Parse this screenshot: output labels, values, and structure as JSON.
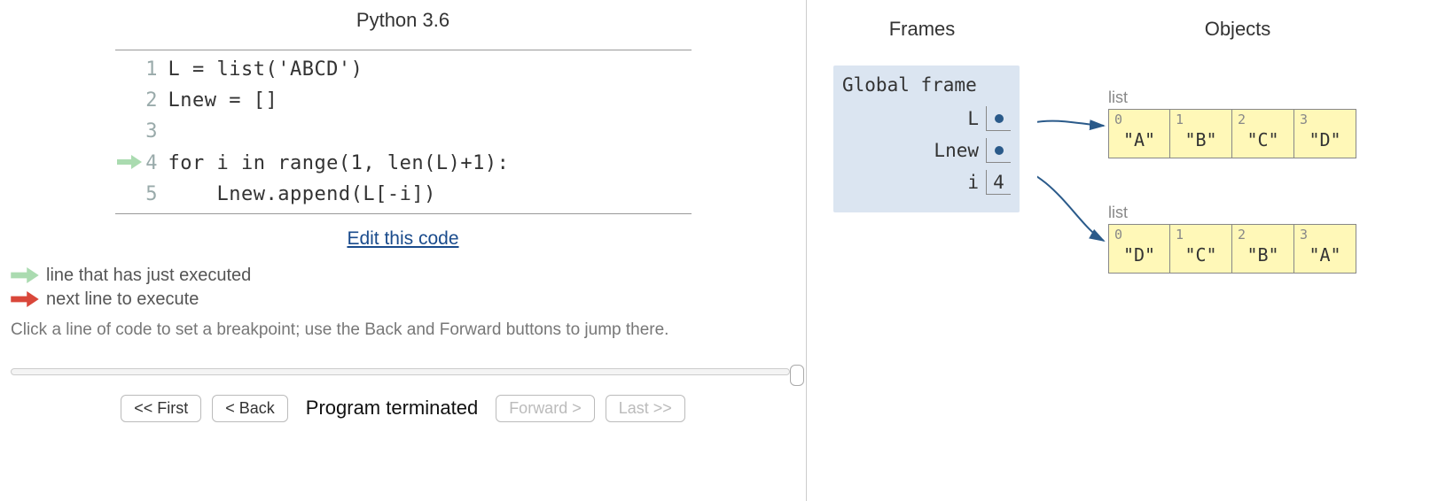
{
  "title": "Python 3.6",
  "code": {
    "lines": [
      {
        "n": "1",
        "text": "L = list('ABCD')"
      },
      {
        "n": "2",
        "text": "Lnew = []"
      },
      {
        "n": "3",
        "text": ""
      },
      {
        "n": "4",
        "text": "for i in range(1, len(L)+1):"
      },
      {
        "n": "5",
        "text": "    Lnew.append(L[-i])"
      }
    ],
    "just_executed_line": 4
  },
  "edit_link": "Edit this code",
  "legend": {
    "just_executed": "line that has just executed",
    "next": "next line to execute"
  },
  "hint": "Click a line of code to set a breakpoint; use the Back and Forward buttons to jump there.",
  "controls": {
    "first": "<< First",
    "back": "< Back",
    "status": "Program terminated",
    "forward": "Forward >",
    "last": "Last >>"
  },
  "right": {
    "frames_header": "Frames",
    "objects_header": "Objects",
    "frame": {
      "title": "Global frame",
      "vars": [
        {
          "name": "L",
          "ref": true
        },
        {
          "name": "Lnew",
          "ref": true
        },
        {
          "name": "i",
          "value": "4"
        }
      ]
    },
    "objects": [
      {
        "type": "list",
        "cells": [
          {
            "idx": "0",
            "val": "\"A\""
          },
          {
            "idx": "1",
            "val": "\"B\""
          },
          {
            "idx": "2",
            "val": "\"C\""
          },
          {
            "idx": "3",
            "val": "\"D\""
          }
        ]
      },
      {
        "type": "list",
        "cells": [
          {
            "idx": "0",
            "val": "\"D\""
          },
          {
            "idx": "1",
            "val": "\"C\""
          },
          {
            "idx": "2",
            "val": "\"B\""
          },
          {
            "idx": "3",
            "val": "\"A\""
          }
        ]
      }
    ]
  }
}
